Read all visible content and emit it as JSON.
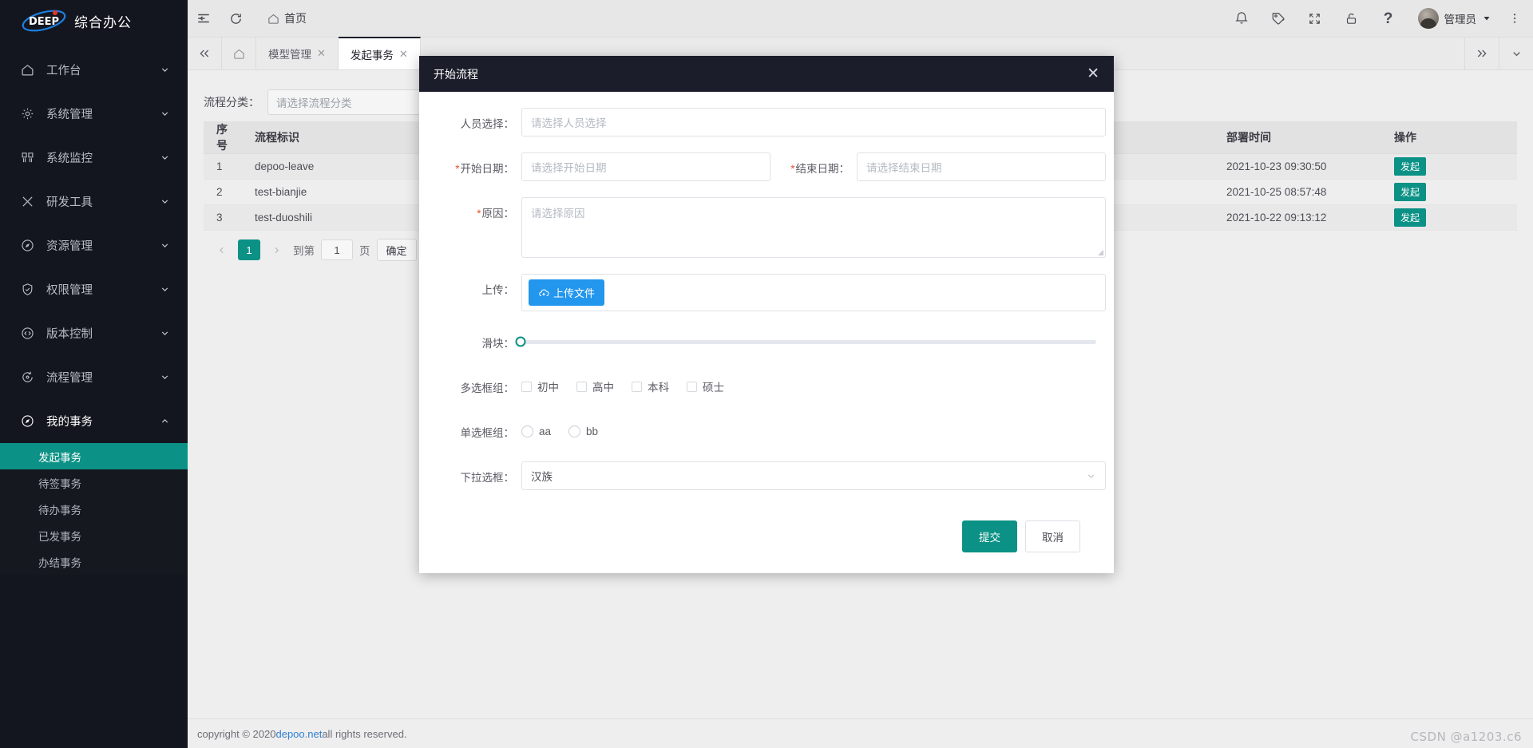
{
  "brand": {
    "logo_text": "DEEP",
    "app_name": "综合办公"
  },
  "sidebar": {
    "items": [
      {
        "label": "工作台",
        "icon": "home-icon"
      },
      {
        "label": "系统管理",
        "icon": "gear-icon"
      },
      {
        "label": "系统监控",
        "icon": "monitor-icon"
      },
      {
        "label": "研发工具",
        "icon": "tools-icon"
      },
      {
        "label": "资源管理",
        "icon": "compass-icon"
      },
      {
        "label": "权限管理",
        "icon": "shield-icon"
      },
      {
        "label": "版本控制",
        "icon": "code-icon"
      },
      {
        "label": "流程管理",
        "icon": "process-icon"
      },
      {
        "label": "我的事务",
        "icon": "compass-icon"
      }
    ],
    "submenu": [
      {
        "label": "发起事务",
        "active": true
      },
      {
        "label": "待签事务",
        "active": false
      },
      {
        "label": "待办事务",
        "active": false
      },
      {
        "label": "已发事务",
        "active": false
      },
      {
        "label": "办结事务",
        "active": false
      }
    ]
  },
  "header": {
    "collapse_icon": "menu-collapse-icon",
    "refresh_icon": "refresh-icon",
    "home_icon": "home-icon",
    "home_label": "首页",
    "icons": [
      "bell-icon",
      "tag-icon",
      "fullscreen-icon",
      "lock-icon",
      "help-icon"
    ],
    "username": "管理员",
    "more_icon": "more-vertical-icon"
  },
  "tabbar": {
    "back_icon": "double-chevron-left-icon",
    "home_icon": "home-icon",
    "tabs": [
      {
        "label": "模型管理",
        "active": false
      },
      {
        "label": "发起事务",
        "active": true
      }
    ],
    "forward_icon": "double-chevron-right-icon",
    "dropdown_icon": "chevron-down-icon"
  },
  "filter": {
    "label": "流程分类：",
    "placeholder": "请选择流程分类"
  },
  "table": {
    "columns": [
      "序号",
      "流程标识",
      "部署时间",
      "操作"
    ],
    "rows": [
      {
        "idx": "1",
        "key": "depoo-leave",
        "time": "2021-10-23 09:30:50",
        "action": "发起"
      },
      {
        "idx": "2",
        "key": "test-bianjie",
        "time": "2021-10-25 08:57:48",
        "action": "发起"
      },
      {
        "idx": "3",
        "key": "test-duoshili",
        "time": "2021-10-22 09:13:12",
        "action": "发起"
      }
    ]
  },
  "pager": {
    "prev_icon": "chevron-left-icon",
    "current_page": "1",
    "next_icon": "chevron-right-icon",
    "goto_label": "到第",
    "goto_value": "1",
    "page_unit": "页",
    "confirm_label": "确定"
  },
  "footer": {
    "prefix": "copyright © 2020 ",
    "link": "depoo.net",
    "suffix": " all rights reserved.",
    "watermark": "CSDN @a1203.c6"
  },
  "modal": {
    "title": "开始流程",
    "close_icon": "close-icon",
    "person": {
      "label": "人员选择：",
      "placeholder": "请选择人员选择"
    },
    "start_date": {
      "label": "开始日期：",
      "placeholder": "请选择开始日期"
    },
    "end_date": {
      "label": "结束日期：",
      "placeholder": "请选择结束日期"
    },
    "reason": {
      "label": "原因：",
      "placeholder": "请选择原因"
    },
    "upload": {
      "label": "上传：",
      "button": "上传文件",
      "icon": "cloud-upload-icon"
    },
    "slider": {
      "label": "滑块：",
      "value": 0
    },
    "checkbox_group": {
      "label": "多选框组：",
      "options": [
        {
          "label": "初中",
          "checked": false
        },
        {
          "label": "高中",
          "checked": false
        },
        {
          "label": "本科",
          "checked": false
        },
        {
          "label": "硕士",
          "checked": false
        }
      ]
    },
    "radio_group": {
      "label": "单选框组：",
      "options": [
        {
          "label": "aa",
          "checked": false
        },
        {
          "label": "bb",
          "checked": false
        }
      ]
    },
    "select": {
      "label": "下拉选框：",
      "value": "汉族",
      "arrow_icon": "chevron-down-icon"
    },
    "submit_label": "提交",
    "cancel_label": "取消"
  }
}
